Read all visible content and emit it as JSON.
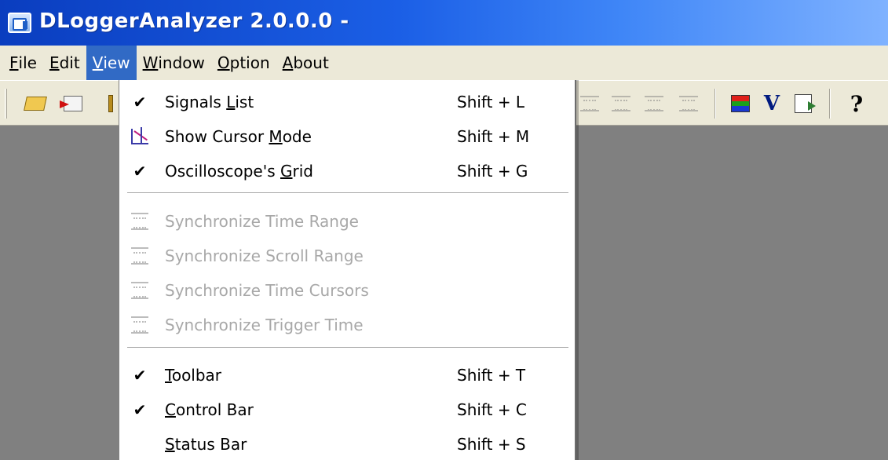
{
  "window": {
    "title": "DLoggerAnalyzer 2.0.0.0 -",
    "app_icon": "app-icon"
  },
  "menubar": {
    "items": [
      {
        "pre": "",
        "u": "F",
        "post": "ile",
        "active": false
      },
      {
        "pre": "",
        "u": "E",
        "post": "dit",
        "active": false
      },
      {
        "pre": "",
        "u": "V",
        "post": "iew",
        "active": true
      },
      {
        "pre": "",
        "u": "W",
        "post": "indow",
        "active": false
      },
      {
        "pre": "",
        "u": "O",
        "post": "ption",
        "active": false
      },
      {
        "pre": "",
        "u": "A",
        "post": "bout",
        "active": false
      }
    ]
  },
  "toolbar": {
    "icons": [
      "open-folder-icon",
      "import-icon",
      "partially-hidden-icon",
      "sync-time-range-icon",
      "sync-scroll-range-icon",
      "sync-time-cursors-icon",
      "sync-trigger-time-icon",
      "color-bars-icon",
      "v-icon",
      "export-icon",
      "help-icon"
    ],
    "colors": {
      "red": "#e0201a",
      "green": "#1aa01a",
      "blue": "#1a38d0"
    }
  },
  "view_menu": {
    "items": [
      {
        "type": "item",
        "checked": true,
        "icon": null,
        "pre": "Signals ",
        "u": "L",
        "post": "ist",
        "shortcut": "Shift + L",
        "enabled": true
      },
      {
        "type": "item",
        "checked": false,
        "icon": "cursor-mode-icon",
        "pre": "Show Cursor ",
        "u": "M",
        "post": "ode",
        "shortcut": "Shift + M",
        "enabled": true
      },
      {
        "type": "item",
        "checked": true,
        "icon": null,
        "pre": "Oscilloscope's ",
        "u": "G",
        "post": "rid",
        "shortcut": "Shift + G",
        "enabled": true
      },
      {
        "type": "separator"
      },
      {
        "type": "item",
        "checked": false,
        "icon": "sync-time-range-icon",
        "pre": "Synchronize Time Range",
        "u": "",
        "post": "",
        "shortcut": "",
        "enabled": false
      },
      {
        "type": "item",
        "checked": false,
        "icon": "sync-scroll-range-icon",
        "pre": "Synchronize Scroll Range",
        "u": "",
        "post": "",
        "shortcut": "",
        "enabled": false
      },
      {
        "type": "item",
        "checked": false,
        "icon": "sync-time-cursors-icon",
        "pre": "Synchronize Time Cursors",
        "u": "",
        "post": "",
        "shortcut": "",
        "enabled": false
      },
      {
        "type": "item",
        "checked": false,
        "icon": "sync-trigger-time-icon",
        "pre": "Synchronize Trigger Time",
        "u": "",
        "post": "",
        "shortcut": "",
        "enabled": false
      },
      {
        "type": "separator"
      },
      {
        "type": "item",
        "checked": true,
        "icon": null,
        "pre": "",
        "u": "T",
        "post": "oolbar",
        "shortcut": "Shift + T",
        "enabled": true
      },
      {
        "type": "item",
        "checked": true,
        "icon": null,
        "pre": "",
        "u": "C",
        "post": "ontrol Bar",
        "shortcut": "Shift + C",
        "enabled": true
      },
      {
        "type": "item",
        "checked": false,
        "icon": null,
        "pre": "",
        "u": "S",
        "post": "tatus Bar",
        "shortcut": "Shift + S",
        "enabled": true
      }
    ]
  },
  "colors": {
    "title_start": "#0a3dbf",
    "title_end": "#7fb2ff",
    "menu_highlight": "#316ac5",
    "workspace": "#808080",
    "disabled_text": "#a8a8a8"
  }
}
